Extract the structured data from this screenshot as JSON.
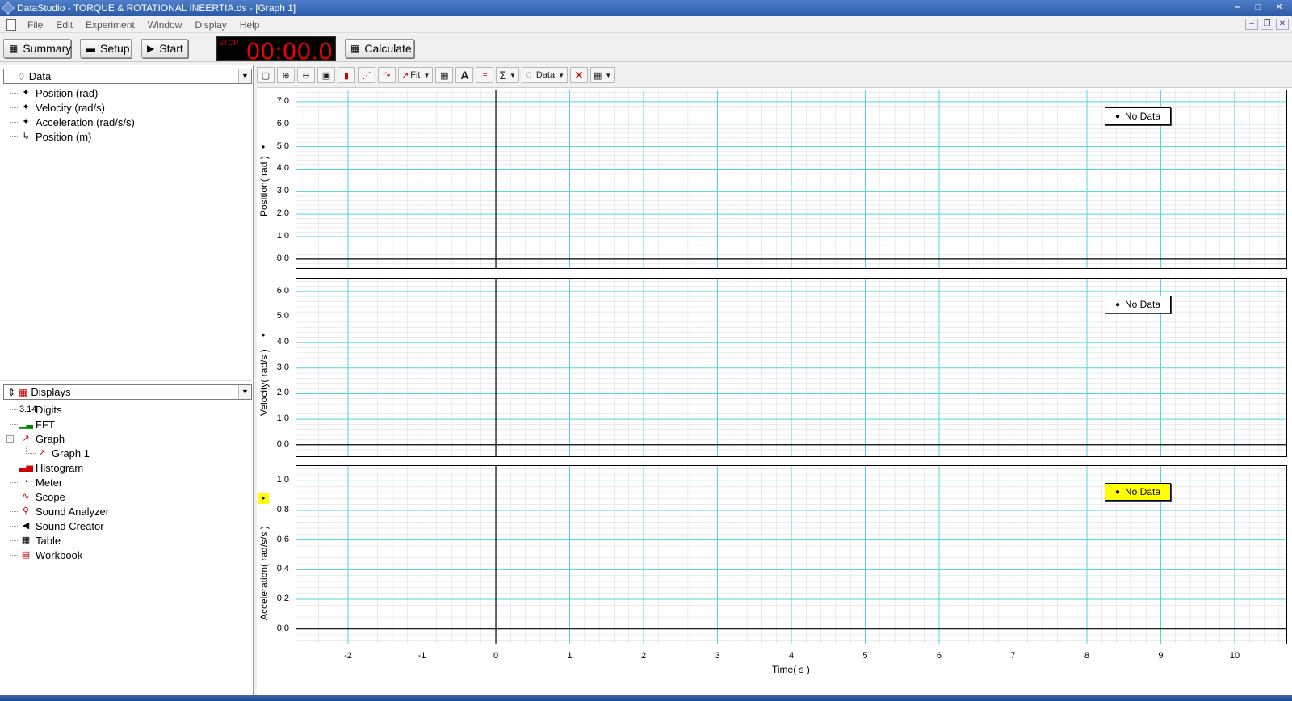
{
  "window": {
    "title": "DataStudio - TORQUE & ROTATIONAL  INEERTIA.ds - [Graph 1]",
    "controls": [
      "–",
      "□",
      "✕"
    ]
  },
  "menu": [
    "File",
    "Edit",
    "Experiment",
    "Window",
    "Display",
    "Help"
  ],
  "mdi_controls": [
    "–",
    "❐",
    "✕"
  ],
  "toolbar": {
    "summary_label": "Summary",
    "setup_label": "Setup",
    "start_label": "Start",
    "calculate_label": "Calculate",
    "timer_status": "STOP",
    "timer_value": "00:00.0"
  },
  "data_panel": {
    "header": "Data",
    "items": [
      {
        "label": "Position (rad)",
        "icon": "rotary-sensor-icon"
      },
      {
        "label": "Velocity (rad/s)",
        "icon": "rotary-sensor-icon"
      },
      {
        "label": "Acceleration (rad/s/s)",
        "icon": "rotary-sensor-icon"
      },
      {
        "label": "Position (m)",
        "icon": "motion-sensor-icon"
      }
    ]
  },
  "displays_panel": {
    "header": "Displays",
    "items": [
      {
        "label": "Digits",
        "icon": "digits-icon"
      },
      {
        "label": "FFT",
        "icon": "fft-icon"
      },
      {
        "label": "Graph",
        "icon": "graph-icon",
        "expanded": true,
        "children": [
          {
            "label": "Graph 1",
            "icon": "graph-icon"
          }
        ]
      },
      {
        "label": "Histogram",
        "icon": "histogram-icon"
      },
      {
        "label": "Meter",
        "icon": "meter-icon"
      },
      {
        "label": "Scope",
        "icon": "scope-icon"
      },
      {
        "label": "Sound Analyzer",
        "icon": "sound-analyzer-icon"
      },
      {
        "label": "Sound Creator",
        "icon": "speaker-icon"
      },
      {
        "label": "Table",
        "icon": "table-icon"
      },
      {
        "label": "Workbook",
        "icon": "workbook-icon"
      }
    ]
  },
  "graph_toolbar": {
    "fit_label": "Fit",
    "data_label": "Data",
    "tools": [
      "scale-to-fit-icon",
      "zoom-in-icon",
      "zoom-out-icon",
      "zoom-select-icon",
      "smart-tool-icon",
      "slope-tool-icon",
      "statistics-curve-icon",
      "fit-icon",
      "calculator-icon",
      "annotation-icon",
      "prediction-icon",
      "sigma-icon",
      "data-icon",
      "delete-icon",
      "settings-icon"
    ]
  },
  "colors": {
    "grid_major": "#4fd6dd",
    "grid_minor": "#d8d8d8",
    "active_highlight": "#ffff00",
    "timer_digits": "#ee0000"
  },
  "chart_data": [
    {
      "type": "line",
      "ylabel": "Position( rad )",
      "xlabel": "",
      "xlim": [
        -2.7,
        10.7
      ],
      "ylim": [
        -0.4,
        7.5
      ],
      "yticks": [
        "0.0",
        "1.0",
        "2.0",
        "3.0",
        "4.0",
        "5.0",
        "6.0",
        "7.0"
      ],
      "ytick_values": [
        0,
        1,
        2,
        3,
        4,
        5,
        6,
        7
      ],
      "legend": "No Data",
      "series": [],
      "grid": true,
      "active": false
    },
    {
      "type": "line",
      "ylabel": "Velocity( rad/s )",
      "xlabel": "",
      "xlim": [
        -2.7,
        10.7
      ],
      "ylim": [
        -0.45,
        6.5
      ],
      "yticks": [
        "0.0",
        "1.0",
        "2.0",
        "3.0",
        "4.0",
        "5.0",
        "6.0"
      ],
      "ytick_values": [
        0,
        1,
        2,
        3,
        4,
        5,
        6
      ],
      "legend": "No Data",
      "series": [],
      "grid": true,
      "active": false
    },
    {
      "type": "line",
      "ylabel": "Acceleration( rad/s/s )",
      "xlabel": "Time( s )",
      "xlim": [
        -2.7,
        10.7
      ],
      "ylim": [
        -0.1,
        1.1
      ],
      "yticks": [
        "0.0",
        "0.2",
        "0.4",
        "0.6",
        "0.8",
        "1.0"
      ],
      "ytick_values": [
        0,
        0.2,
        0.4,
        0.6,
        0.8,
        1.0
      ],
      "xticks": [
        "-2",
        "-1",
        "0",
        "1",
        "2",
        "3",
        "4",
        "5",
        "6",
        "7",
        "8",
        "9",
        "10"
      ],
      "xtick_values": [
        -2,
        -1,
        0,
        1,
        2,
        3,
        4,
        5,
        6,
        7,
        8,
        9,
        10
      ],
      "legend": "No Data",
      "series": [],
      "grid": true,
      "active": true
    }
  ]
}
